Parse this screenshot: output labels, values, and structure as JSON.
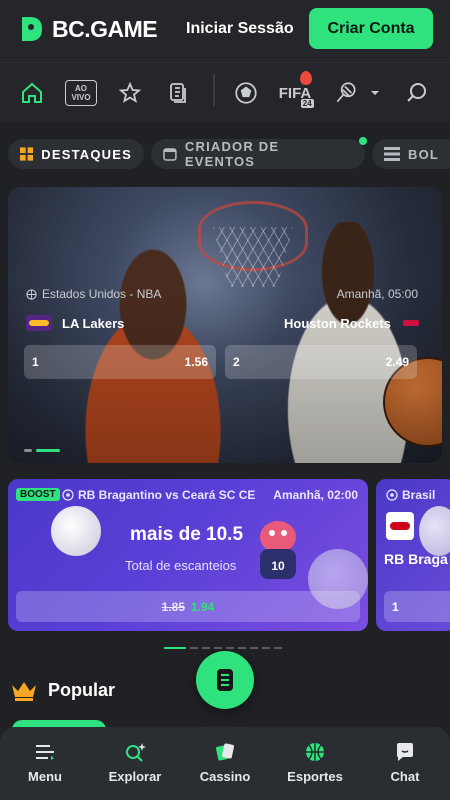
{
  "header": {
    "brand": "BC.GAME",
    "login_label": "Iniciar Sessão",
    "signup_label": "Criar Conta"
  },
  "categories": [
    {
      "name": "home-icon",
      "label": ""
    },
    {
      "name": "ao-vivo-icon",
      "label": "AO VIVO"
    },
    {
      "name": "star-icon",
      "label": ""
    },
    {
      "name": "betslip-icon",
      "label": ""
    },
    {
      "name": "soccer-icon",
      "label": ""
    },
    {
      "name": "fifa-icon",
      "label": "FIFA",
      "badge": "24"
    },
    {
      "name": "tennis-icon",
      "label": ""
    },
    {
      "name": "chevron-down-icon",
      "label": ""
    },
    {
      "name": "search-icon",
      "label": ""
    }
  ],
  "chips": {
    "highlights": "DESTAQUES",
    "event_creator": "CRIADOR DE EVENTOS",
    "third": "BOL"
  },
  "hero": {
    "league": "Estados Unidos - NBA",
    "time": "Amanhã, 05:00",
    "team_home": "LA Lakers",
    "team_away": "Houston Rockets",
    "odds": [
      {
        "label": "1",
        "value": "1.56"
      },
      {
        "label": "2",
        "value": "2.49"
      }
    ]
  },
  "boost": {
    "tag": "BOOST",
    "match": "RB Bragantino vs Ceará SC CE",
    "time": "Amanhã, 02:00",
    "headline": "mais de 10.5",
    "subline": "Total de escanteios",
    "old_odd": "1.85",
    "new_odd": "1.94"
  },
  "boost2": {
    "league": "Brasil",
    "team": "RB Braga",
    "odd_label": "1"
  },
  "section": {
    "popular": "Popular"
  },
  "bottom_nav": [
    {
      "label": "Menu"
    },
    {
      "label": "Explorar"
    },
    {
      "label": "Cassino"
    },
    {
      "label": "Esportes"
    },
    {
      "label": "Chat"
    }
  ],
  "colors": {
    "accent": "#2fe27d",
    "background": "#1f2124",
    "boost_purple": "#5a3fd6"
  }
}
